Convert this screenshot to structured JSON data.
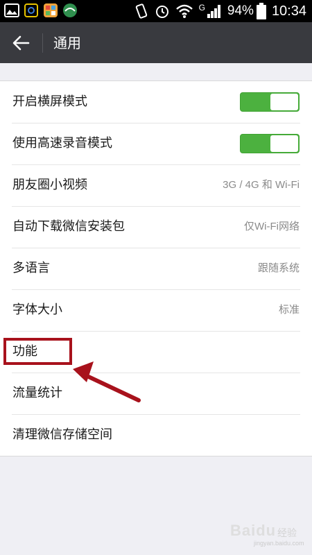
{
  "status_bar": {
    "network": "G",
    "battery": "94%",
    "time": "10:34",
    "icons": [
      "gallery-icon",
      "ringtone-icon",
      "app-icon",
      "green-circle-icon",
      "vibrate-icon",
      "alarm-icon",
      "wifi-icon",
      "signal-icon",
      "battery-icon"
    ]
  },
  "header": {
    "back_icon": "arrow-left-icon",
    "title": "通用"
  },
  "settings": {
    "items": [
      {
        "label": "开启横屏模式",
        "type": "toggle",
        "on": true
      },
      {
        "label": "使用高速录音模式",
        "type": "toggle",
        "on": true
      },
      {
        "label": "朋友圈小视频",
        "type": "value",
        "value": "3G / 4G 和 Wi-Fi"
      },
      {
        "label": "自动下载微信安装包",
        "type": "value",
        "value": "仅Wi-Fi网络"
      },
      {
        "label": "多语言",
        "type": "value",
        "value": "跟随系统"
      },
      {
        "label": "字体大小",
        "type": "value",
        "value": "标准"
      },
      {
        "label": "功能",
        "type": "link"
      },
      {
        "label": "流量统计",
        "type": "link"
      },
      {
        "label": "清理微信存储空间",
        "type": "link"
      }
    ]
  },
  "colors": {
    "statusbar_bg": "#000000",
    "titlebar_bg": "#393a3f",
    "page_bg": "#efeff4",
    "toggle_on": "#4cb13f",
    "annotation": "#a8121c"
  },
  "watermark": {
    "brand": "Baidu",
    "sub": "经验",
    "url": "jingyan.baidu.com"
  }
}
